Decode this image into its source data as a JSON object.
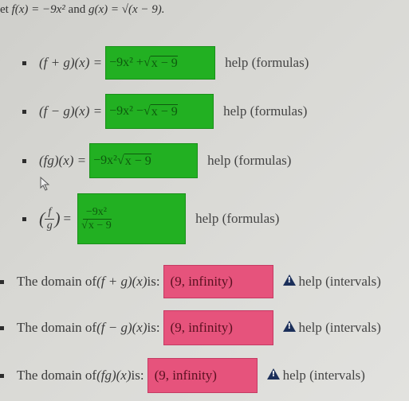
{
  "intro": {
    "prefix": "et ",
    "f_def": "f(x) = −9x²",
    "and": " and ",
    "g_def": "g(x) = √(x − 9)."
  },
  "formulas": [
    {
      "label": "(f + g)(x) =",
      "answer_parts": {
        "pre": "−9x² + ",
        "rad": "x − 9"
      },
      "help": "help (formulas)",
      "status": "correct"
    },
    {
      "label": "(f − g)(x) =",
      "answer_parts": {
        "pre": "−9x² − ",
        "rad": "x − 9"
      },
      "help": "help (formulas)",
      "status": "correct"
    },
    {
      "label": "(fg)(x) =",
      "answer_parts": {
        "pre": "−9x²",
        "rad": "x − 9"
      },
      "help": "help (formulas)",
      "status": "correct"
    },
    {
      "label_num": "f",
      "label_den": "g",
      "label_eq": "=",
      "answer_parts": {
        "num": "−9x²",
        "den_rad": "x − 9"
      },
      "help": "help (formulas)",
      "status": "correct"
    }
  ],
  "domains": [
    {
      "label_prefix": "The domain of ",
      "label_fn": "(f + g)(x)",
      "label_suffix": " is:",
      "value": "(9, infinity)",
      "help": "help (intervals)",
      "status": "incorrect"
    },
    {
      "label_prefix": "The domain of ",
      "label_fn": "(f − g)(x)",
      "label_suffix": " is:",
      "value": "(9, infinity)",
      "help": "help (intervals)",
      "status": "incorrect"
    },
    {
      "label_prefix": "The domain of ",
      "label_fn": "(fg)(x)",
      "label_suffix": " is:",
      "value": "(9, infinity)",
      "help": "help (intervals)",
      "status": "incorrect"
    }
  ],
  "colors": {
    "correct": "#22b022",
    "incorrect": "#e6537c",
    "warning_icon": "#1b2f5a"
  }
}
